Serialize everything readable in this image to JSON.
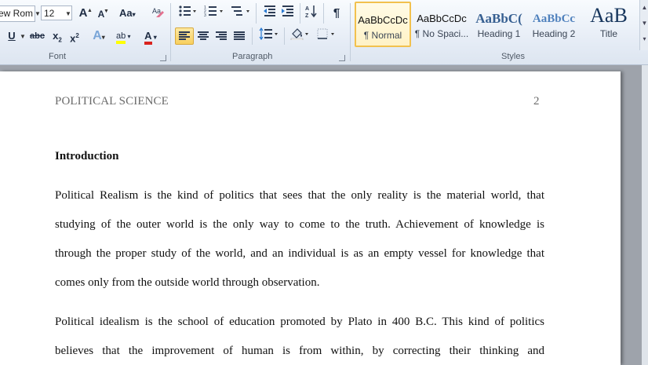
{
  "ribbon": {
    "font": {
      "name": "ew Rom",
      "size": "12",
      "grow": "A",
      "shrink": "A",
      "change_case": "Aa",
      "underline": "U",
      "strike": "abc",
      "subscript": "x",
      "superscript": "x",
      "sub_mark": "2",
      "sup_mark": "2",
      "text_effects": "A",
      "highlight": "ab",
      "font_color": "A",
      "group_label": "Font"
    },
    "paragraph": {
      "group_label": "Paragraph",
      "pilcrow": "¶"
    },
    "styles": {
      "group_label": "Styles",
      "tiles": [
        {
          "sample": "AaBbCcDc",
          "name": "¶ Normal"
        },
        {
          "sample": "AaBbCcDc",
          "name": "¶ No Spaci..."
        },
        {
          "sample": "AaBbC(",
          "name": "Heading 1"
        },
        {
          "sample": "AaBbCc",
          "name": "Heading 2"
        },
        {
          "sample": "AaB",
          "name": "Title"
        }
      ]
    },
    "colors": {
      "highlight": "#ffff00",
      "font_color": "#d9231e",
      "heading_blue": "#365f91",
      "heading2_blue": "#4f81bd",
      "selected_border": "#f2c14e"
    }
  },
  "document": {
    "header_left": "POLITICAL SCIENCE",
    "page_number": "2",
    "heading": "Introduction",
    "lines": [
      "Political Realism is the kind of politics that sees that the only reality is the material world, that",
      "studying of the outer world is the only way to come to the truth. Achievement of knowledge is",
      "through the proper study of the world, and an individual is as an empty vessel for knowledge that",
      "comes only from the outside world through observation.",
      "Political idealism is the school of education promoted by Plato in 400 B.C. This kind of politics",
      "believes that the improvement of human is from within, by correcting their thinking and"
    ]
  }
}
